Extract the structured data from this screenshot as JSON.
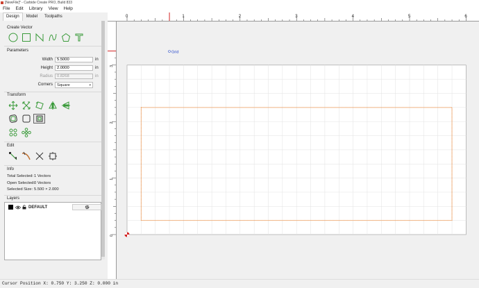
{
  "window": {
    "title": "[NewFile]* - Carbide Create PRO, Build 833"
  },
  "menu": [
    "File",
    "Edit",
    "Library",
    "View",
    "Help"
  ],
  "tabs": [
    {
      "label": "Design",
      "active": true
    },
    {
      "label": "Model",
      "active": false
    },
    {
      "label": "Toolpaths",
      "active": false
    }
  ],
  "create_vector": {
    "title": "Create Vector",
    "tools": [
      "circle-icon",
      "rectangle-icon",
      "polyline-icon",
      "curve-icon",
      "polygon-icon",
      "text-icon"
    ]
  },
  "parameters": {
    "title": "Parameters",
    "width": {
      "label": "Width",
      "value": "5.5000",
      "unit": "in"
    },
    "height": {
      "label": "Height",
      "value": "2.0000",
      "unit": "in"
    },
    "radius": {
      "label": "Radius",
      "value": "0.8268",
      "unit": "in"
    },
    "corners": {
      "label": "Corners",
      "value": "Square"
    }
  },
  "transform": {
    "title": "Transform"
  },
  "edit": {
    "title": "Edit"
  },
  "info": {
    "title": "Info",
    "total_selected": {
      "label": "Total Selected:",
      "value": "1 Vectors"
    },
    "open_selected": {
      "label": "Open Selected:",
      "value": "0 Vectors"
    },
    "selected_size": {
      "label": "Selected Size:",
      "value": "5.500 × 2.000"
    }
  },
  "layers": {
    "title": "Layers",
    "items": [
      {
        "name": "DEFAULT",
        "color": "#000000"
      }
    ]
  },
  "canvas": {
    "grid_label": "Grid",
    "ruler_x": [
      "0",
      "1",
      "2",
      "3",
      "4",
      "5",
      "6"
    ],
    "ruler_y": [
      "0",
      "1",
      "2",
      "3"
    ],
    "selection_color": "#f08a3a",
    "accent_color": "#d22222"
  },
  "status": {
    "cursor_text": "Cursor Position X: 0.750 Y: 3.250 Z: 0.000 in"
  }
}
